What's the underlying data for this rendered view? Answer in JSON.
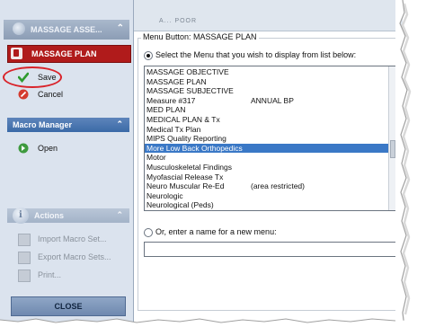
{
  "sidebar": {
    "top_header": "MASSAGE ASSE...",
    "current_item": "MASSAGE PLAN",
    "save_label": "Save",
    "cancel_label": "Cancel",
    "macro_manager_header": "Macro Manager",
    "open_label": "Open",
    "actions_header": "Actions",
    "import_label": "Import Macro Set...",
    "export_label": "Export Macro Sets...",
    "print_label": "Print...",
    "close_label": "CLOSE"
  },
  "panel": {
    "cut_text": "A...           POOR",
    "group_title": "Menu Button: MASSAGE PLAN",
    "select_option_label": "Select the Menu that you wish to display from list below:",
    "new_menu_option_label": "Or, enter a name for a new menu:",
    "new_menu_value": "",
    "menus": [
      {
        "name": "MASSAGE OBJECTIVE",
        "note": ""
      },
      {
        "name": "MASSAGE PLAN",
        "note": ""
      },
      {
        "name": "MASSAGE SUBJECTIVE",
        "note": ""
      },
      {
        "name": "Measure #317",
        "note": "ANNUAL BP"
      },
      {
        "name": "MED PLAN",
        "note": ""
      },
      {
        "name": "MEDICAL PLAN & Tx",
        "note": ""
      },
      {
        "name": "Medical Tx Plan",
        "note": ""
      },
      {
        "name": "MIPS Quality Reporting",
        "note": ""
      },
      {
        "name": "More Low Back Orthopedics",
        "note": ""
      },
      {
        "name": "Motor",
        "note": ""
      },
      {
        "name": "Musculoskeletal Findings",
        "note": ""
      },
      {
        "name": "Myofascial Release Tx",
        "note": ""
      },
      {
        "name": "Neuro Muscular Re-Ed",
        "note": "(area restricted)"
      },
      {
        "name": "Neurologic",
        "note": ""
      },
      {
        "name": "Neurological (Peds)",
        "note": ""
      }
    ],
    "selected_menu": "More Low Back Orthopedics"
  },
  "colors": {
    "selection": "#3a78c6",
    "current_item_bg": "#b01b1b",
    "highlight_oval": "#d9232a",
    "macro_header": "#4a76b1"
  }
}
